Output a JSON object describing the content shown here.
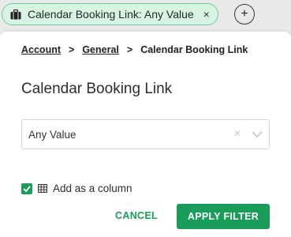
{
  "chip": {
    "label": "Calendar Booking Link: Any Value",
    "close_glyph": "×",
    "icon": "briefcase-icon"
  },
  "add_button": {
    "glyph": "+"
  },
  "breadcrumb": {
    "items": [
      "Account",
      "General",
      "Calendar Booking Link"
    ],
    "separator": ">"
  },
  "panel": {
    "title": "Calendar Booking Link"
  },
  "select": {
    "value": "Any Value",
    "clear_glyph": "×"
  },
  "column_option": {
    "label": "Add as a column",
    "checked": true
  },
  "actions": {
    "cancel": "CANCEL",
    "apply": "APPLY FILTER"
  },
  "colors": {
    "accent": "#1a9c5b",
    "chip_bg": "#d8f3e3",
    "chip_border": "#6ccb95"
  }
}
